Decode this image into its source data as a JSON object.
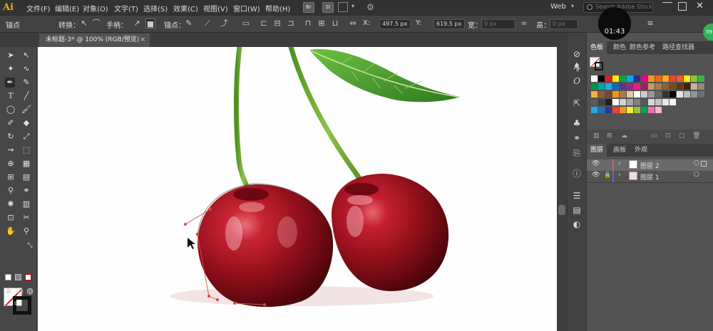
{
  "app": {
    "logo": "Ai",
    "workspace": "Web",
    "search_placeholder": "Search Adobe Stock",
    "timer": "01:43",
    "badge": "59"
  },
  "menus": [
    "文件(F)",
    "编辑(E)",
    "对象(O)",
    "文字(T)",
    "选择(S)",
    "效果(C)",
    "视图(V)",
    "窗口(W)",
    "帮助(H)"
  ],
  "menu_buttons": [
    "Br",
    "St"
  ],
  "control": {
    "anchor_label": "锚点",
    "convert_label": "转换：",
    "handle_label": "手柄：",
    "anchor2_label": "锚点：",
    "x_label": "X:",
    "x_value": "497.5 px",
    "y_label": "Y:",
    "y_value": "619.5 px",
    "w_label": "宽：",
    "w_value": "0 px",
    "h_label": "高：",
    "h_value": "0 px"
  },
  "document": {
    "tab_title": "未标题-3* @ 100% (RGB/预览)",
    "close": "×"
  },
  "panels": {
    "swatch_tabs": [
      "色板",
      "颜色",
      "颜色参考",
      "路径查找器"
    ],
    "layer_tabs": [
      "图层",
      "画板",
      "外观"
    ],
    "layers": [
      {
        "name": "图层 2",
        "color": "#e05a5a"
      },
      {
        "name": "图层 1",
        "color": "#4f6bd8"
      }
    ]
  },
  "colors": {
    "menubar": "#323232",
    "controlbar": "#424242",
    "panel": "#535353",
    "logo": "#f7a800",
    "cherry": "#a8101f",
    "leaf": "#3d8f2a",
    "stem": "#6aa82e",
    "path": "#d94a4a"
  }
}
